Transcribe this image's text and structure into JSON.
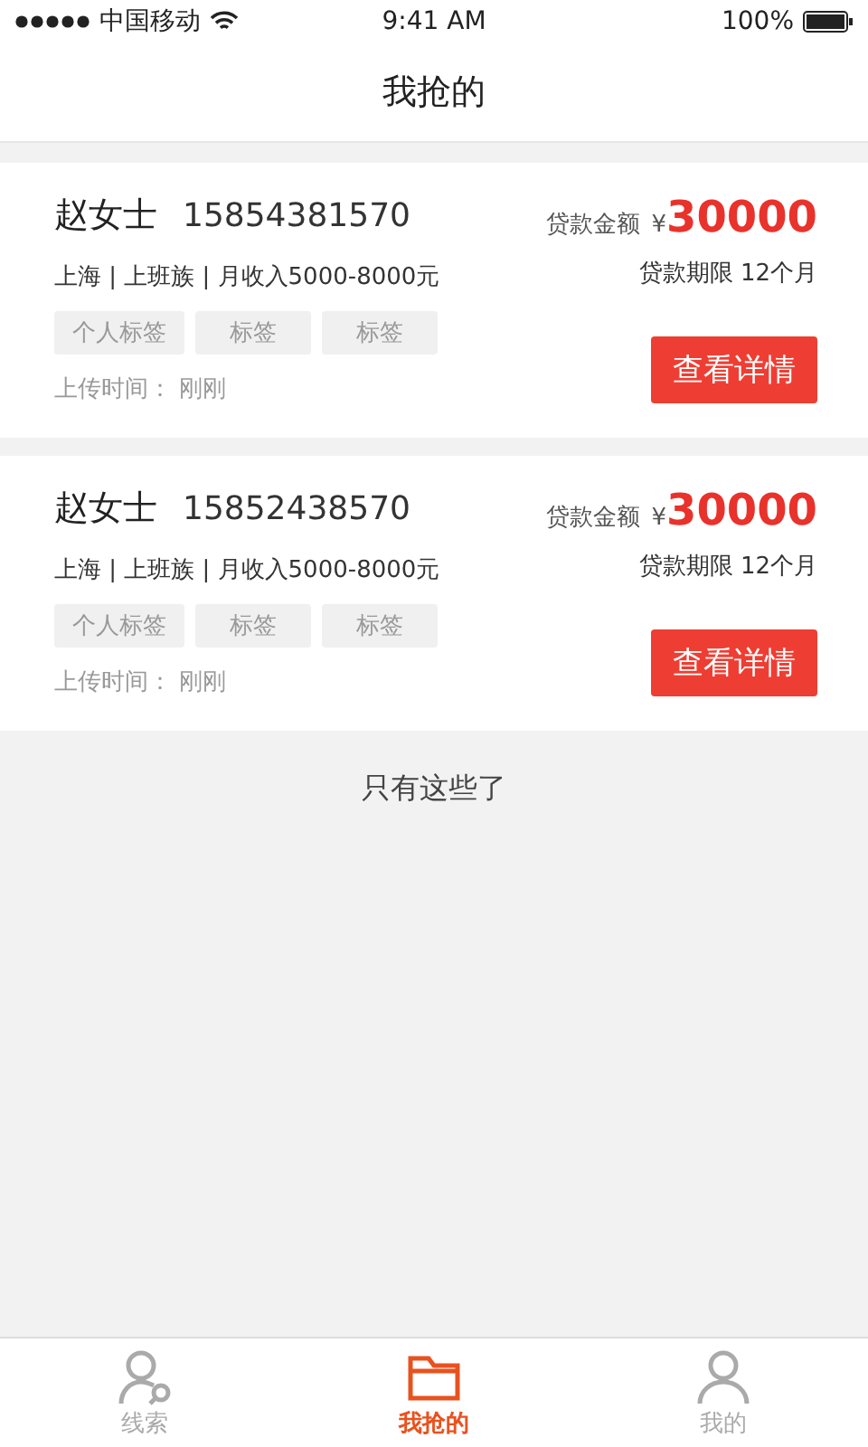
{
  "status_bar": {
    "carrier": "中国移动",
    "time": "9:41 AM",
    "battery": "100%"
  },
  "nav": {
    "title": "我抢的"
  },
  "leads": [
    {
      "name": "赵女士",
      "phone": "15854381570",
      "info": "上海 | 上班族 | 月收入5000-8000元",
      "tags": [
        "个人标签",
        "标签",
        "标签"
      ],
      "upload_label": "上传时间：",
      "upload_time": "刚刚",
      "amount_label": "贷款金额",
      "currency": "¥",
      "amount": "30000",
      "term": "贷款期限 12个月",
      "button": "查看详情"
    },
    {
      "name": "赵女士",
      "phone": "15852438570",
      "info": "上海 | 上班族 | 月收入5000-8000元",
      "tags": [
        "个人标签",
        "标签",
        "标签"
      ],
      "upload_label": "上传时间：",
      "upload_time": "刚刚",
      "amount_label": "贷款金额",
      "currency": "¥",
      "amount": "30000",
      "term": "贷款期限 12个月",
      "button": "查看详情"
    }
  ],
  "end_note": "只有这些了",
  "tabs": [
    {
      "label": "线索",
      "kind": "person-search",
      "selected": false
    },
    {
      "label": "我抢的",
      "kind": "folder",
      "selected": true
    },
    {
      "label": "我的",
      "kind": "person",
      "selected": false
    }
  ]
}
